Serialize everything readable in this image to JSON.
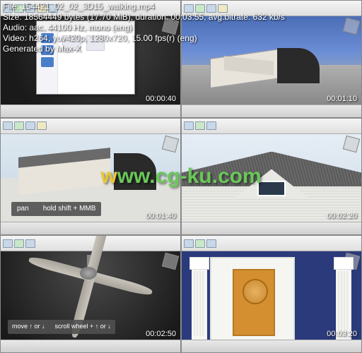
{
  "info": {
    "file": "File: 154421_02_02_3D15_walking.mp4",
    "size": "Size: 18564449 bytes (17.70 MiB), duration: 00:03:55, avg.bitrate: 632 kb/s",
    "audio": "Audio: aac, 44100 Hz, mono (eng)",
    "video": "Video: h264, yuv420p, 1280x720, 15.00 fps(r) (eng)",
    "gen": "Generated by Max-X"
  },
  "thumbs": [
    {
      "ts": "00:00:40"
    },
    {
      "ts": "00:01:10"
    },
    {
      "ts": "00:01:40",
      "tip_a": "pan",
      "tip_b": "hold shift + MMB"
    },
    {
      "ts": "00:02:20"
    },
    {
      "ts": "00:02:50",
      "tip_a": "move ↑ or ↓",
      "tip_b": "scroll wheel + ↑ or ↓"
    },
    {
      "ts": "00:03:20"
    }
  ],
  "watermark": {
    "w": "w",
    "rest": "ww.cg-ku.com"
  }
}
